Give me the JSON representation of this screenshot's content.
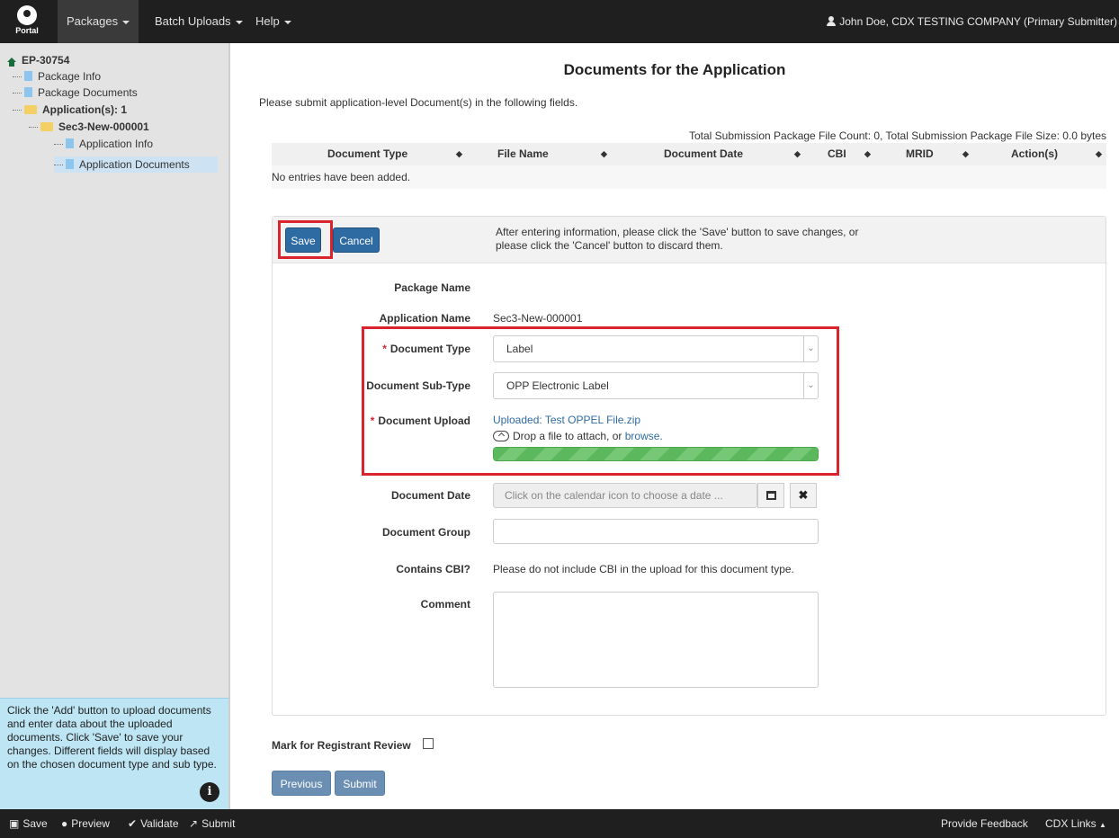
{
  "topnav": {
    "logo_text": "Portal",
    "menus": [
      {
        "label": "Packages"
      },
      {
        "label": "Batch Uploads"
      },
      {
        "label": "Help"
      }
    ],
    "user": "John Doe, CDX TESTING COMPANY (Primary Submitter)"
  },
  "sidebar": {
    "tree": {
      "root": "EP-30754",
      "package_info": "Package Info",
      "package_documents": "Package Documents",
      "applications": "Application(s): 1",
      "application": "Sec3-New-000001",
      "application_info": "Application Info",
      "application_documents": "Application Documents"
    },
    "help_text": "Click the 'Add' button to upload documents and enter data about the uploaded documents. Click 'Save' to save your changes. Different fields will display based on the chosen document type and sub type."
  },
  "main": {
    "title": "Documents for the Application",
    "intro": "Please submit application-level Document(s) in the following fields.",
    "totals": "Total Submission Package File Count: 0, Total Submission Package File Size: 0.0 bytes",
    "columns": [
      "Document Type",
      "File Name",
      "Document Date",
      "CBI",
      "MRID",
      "Action(s)"
    ],
    "empty_message": "No entries have been added.",
    "form": {
      "save_label": "Save",
      "cancel_label": "Cancel",
      "toolbar_message_line1": "After entering information, please click the 'Save' button to save changes, or",
      "toolbar_message_line2": "please click the 'Cancel' button to discard them.",
      "package_name_label": "Package Name",
      "package_name_value": "",
      "application_name_label": "Application Name",
      "application_name_value": "Sec3-New-000001",
      "document_type_label": "Document Type",
      "document_type_value": "Label",
      "document_subtype_label": "Document Sub-Type",
      "document_subtype_value": "OPP Electronic Label",
      "document_upload_label": "Document Upload",
      "uploaded_file": "Uploaded: Test OPPEL File.zip",
      "drop_text": "Drop a file to attach, or",
      "browse_label": "browse.",
      "upload_progress": 1.0,
      "document_date_label": "Document Date",
      "document_date_placeholder": "Click on the calendar icon to choose a date ...",
      "document_group_label": "Document Group",
      "document_group_value": "",
      "contains_cbi_label": "Contains CBI?",
      "contains_cbi_text": "Please do not include CBI in the upload for this document type.",
      "comment_label": "Comment",
      "comment_value": ""
    },
    "mark_review_label": "Mark for Registrant Review",
    "mark_review_checked": false,
    "previous_label": "Previous",
    "submit_label": "Submit"
  },
  "bottombar": {
    "save": "Save",
    "preview": "Preview",
    "validate": "Validate",
    "submit": "Submit",
    "feedback": "Provide Feedback",
    "cdx_links": "CDX Links"
  },
  "colors": {
    "nav_bg": "#1f1f1f",
    "primary_button": "#2f6ba3",
    "highlight_red": "#d9232d",
    "progress_green": "#5cb85c",
    "help_bg": "#bde5f3"
  }
}
